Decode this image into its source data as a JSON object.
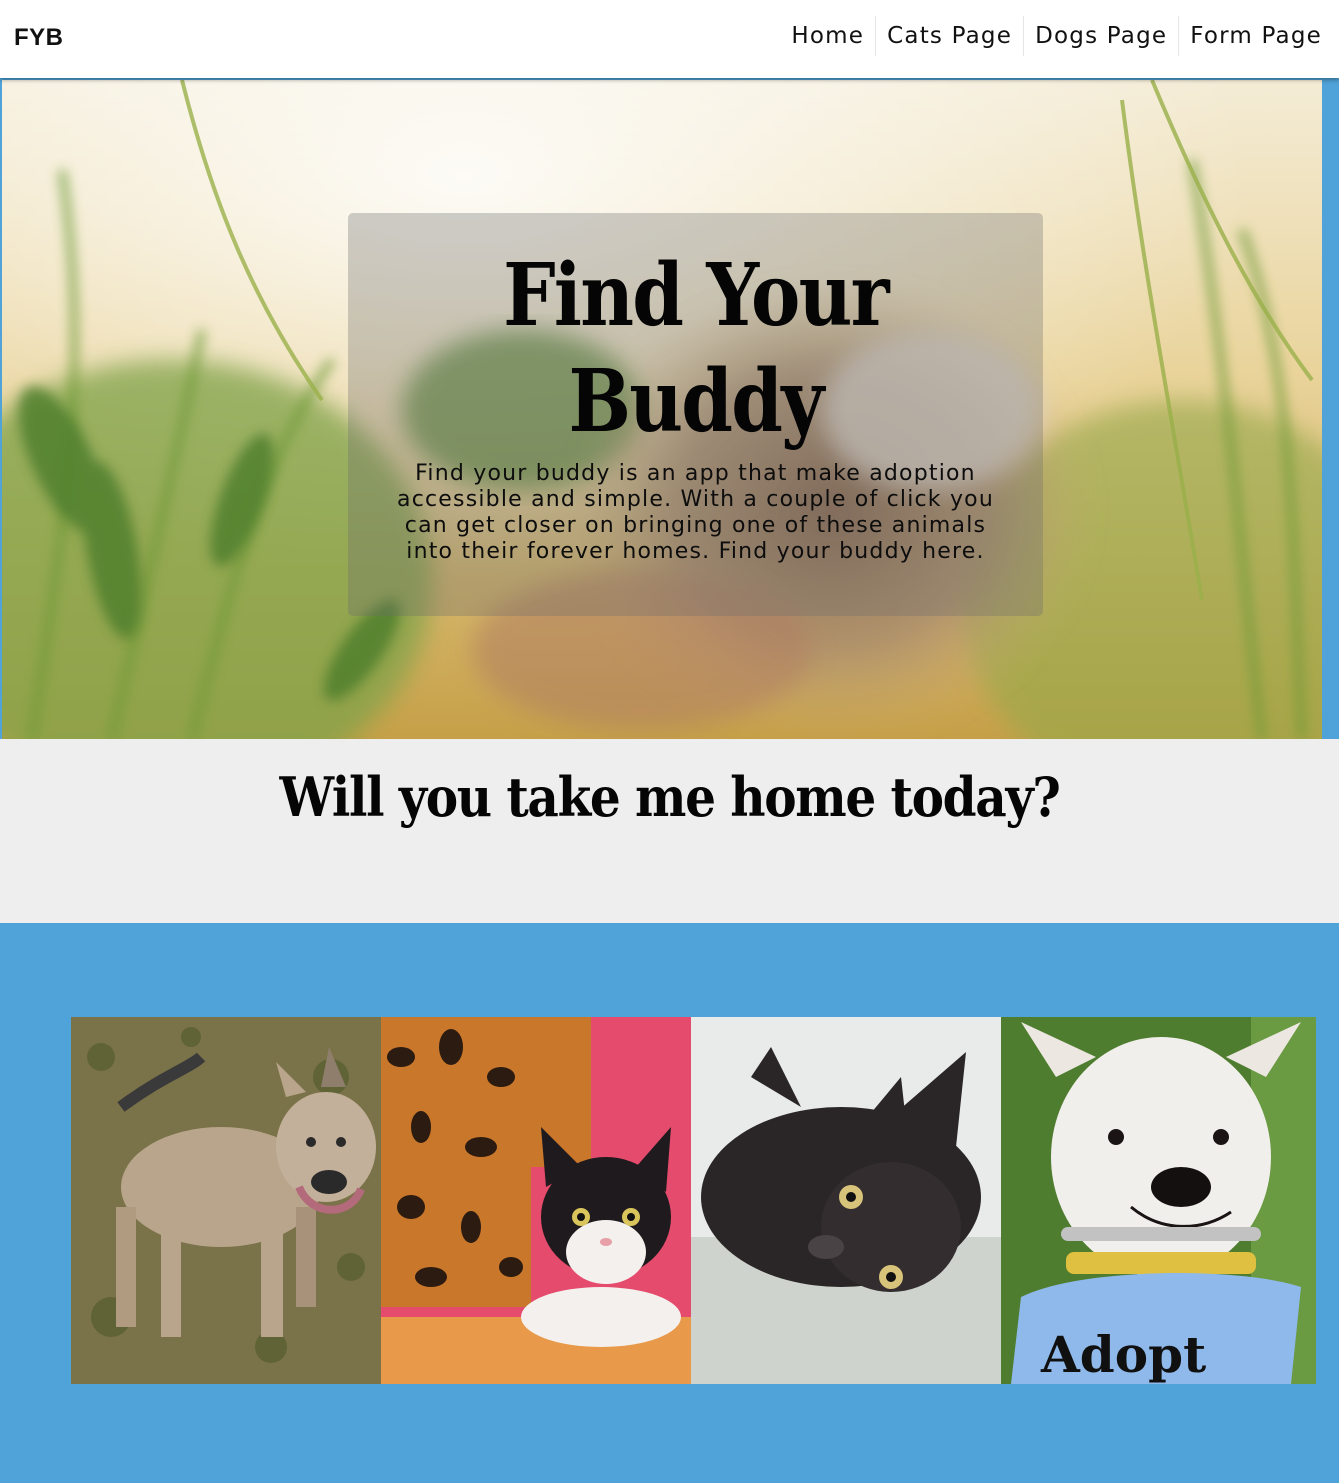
{
  "nav": {
    "brand": "FYB",
    "links": [
      "Home",
      "Cats Page",
      "Dogs Page",
      "Form Page"
    ]
  },
  "hero": {
    "title_line1": "Find Your",
    "title_line2": "Buddy",
    "text": "Find your buddy is an app that make adoption accessible and simple. With a couple of click you can get closer on bringing one of these animals into their forever homes. Find your buddy here."
  },
  "band": {
    "title": "Will you take me home today?"
  },
  "gallery": {
    "bandana_text": "Adopt"
  },
  "colors": {
    "page_background": "#4fa3d8",
    "band_background": "#eeeeee",
    "navbar_background": "#ffffff"
  }
}
